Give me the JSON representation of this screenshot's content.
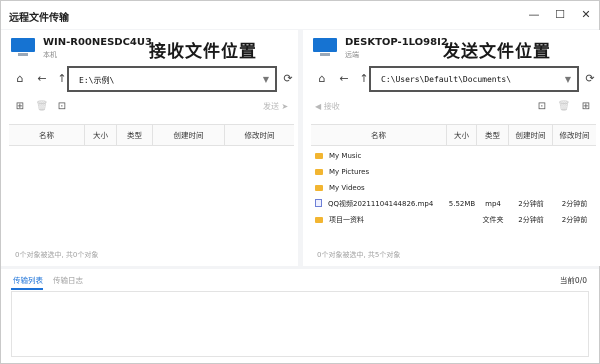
{
  "window": {
    "title": "远程文件传输",
    "controls": {
      "minimize": "—",
      "maximize": "☐",
      "close": "✕"
    }
  },
  "left": {
    "host_name": "WIN-R00NESDC4U3",
    "host_sub": "本机",
    "annotation": "接收文件位置",
    "path": "E:\\示例\\",
    "send_label": "发送",
    "columns": [
      "名称",
      "大小",
      "类型",
      "创建时间",
      "修改时间"
    ],
    "rows": [],
    "status": "0个对象被选中, 共0个对象"
  },
  "right": {
    "host_name": "DESKTOP-1LO98I2",
    "host_sub": "远端",
    "annotation": "发送文件位置",
    "path": "C:\\Users\\Default\\Documents\\",
    "receive_label": "接收",
    "columns": [
      "名称",
      "大小",
      "类型",
      "创建时间",
      "修改时间"
    ],
    "rows": [
      {
        "icon": "folder-icon",
        "name": "My Music",
        "size": "",
        "type": "",
        "created": "",
        "modified": ""
      },
      {
        "icon": "folder-icon",
        "name": "My Pictures",
        "size": "",
        "type": "",
        "created": "",
        "modified": ""
      },
      {
        "icon": "folder-icon",
        "name": "My Videos",
        "size": "",
        "type": "",
        "created": "",
        "modified": ""
      },
      {
        "icon": "video-file-icon",
        "name": "QQ视频20211104144826.mp4",
        "size": "5.52MB",
        "type": "mp4",
        "created": "2分钟前",
        "modified": "2分钟前"
      },
      {
        "icon": "folder-icon",
        "name": "项目一资料",
        "size": "",
        "type": "文件夹",
        "created": "2分钟前",
        "modified": "2分钟前"
      }
    ],
    "status": "0个对象被选中, 共5个对象"
  },
  "bottom": {
    "tabs": [
      "传输列表",
      "传输日志"
    ],
    "count": "当前0/0"
  },
  "colors": {
    "accent": "#1e73d8",
    "folder": "#f2b531",
    "monitor": "#1673d2"
  }
}
